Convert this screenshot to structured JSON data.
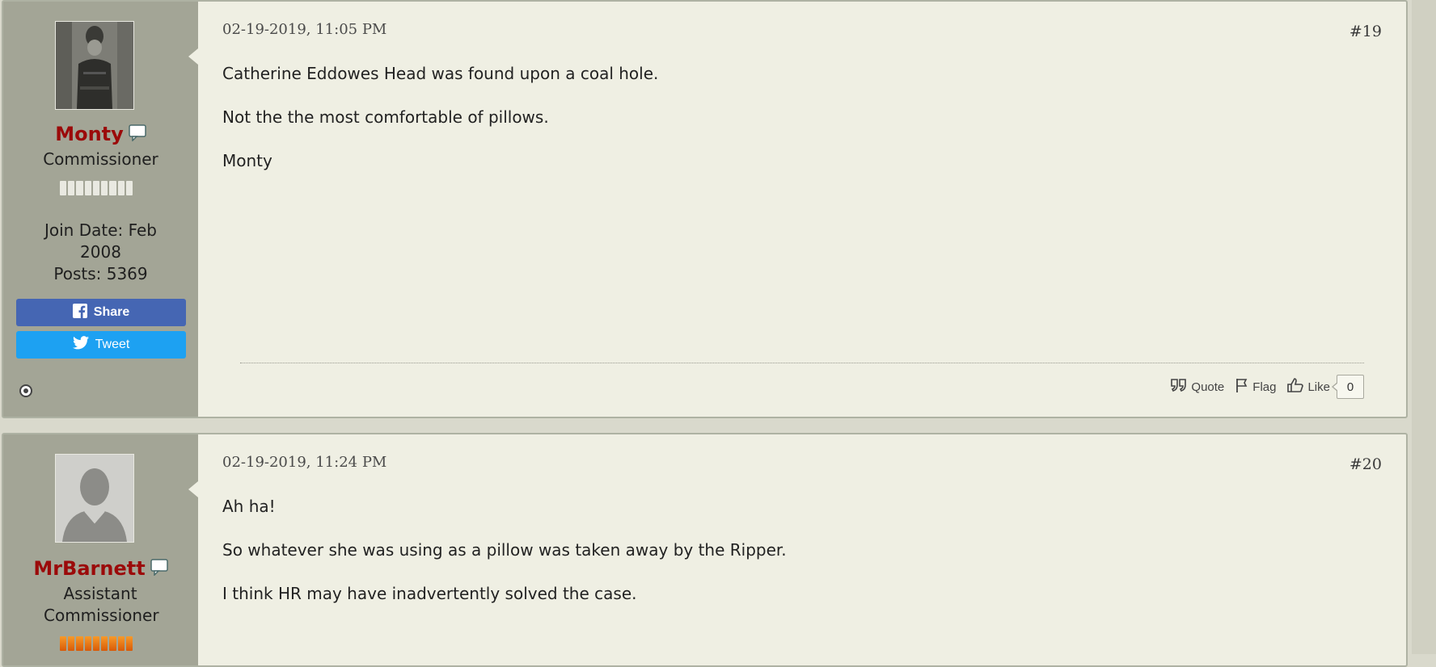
{
  "posts": [
    {
      "username": "Monty",
      "user_title": "Commissioner",
      "join_date": "Join Date: Feb 2008",
      "posts_count": "Posts: 5369",
      "share_label": "Share",
      "tweet_label": "Tweet",
      "date": "02-19-2019, 11:05 PM",
      "post_number": "#19",
      "paragraphs": [
        "Catherine Eddowes Head was found upon a coal hole.",
        "Not the the most comfortable of pillows.",
        "Monty"
      ],
      "actions": {
        "quote": "Quote",
        "flag": "Flag",
        "like": "Like",
        "like_count": "0"
      }
    },
    {
      "username": "MrBarnett",
      "user_title": "Assistant Commissioner",
      "date": "02-19-2019, 11:24 PM",
      "post_number": "#20",
      "paragraphs": [
        "Ah ha!",
        "So whatever she was using as a pillow was taken away by the Ripper.",
        "I think HR may have inadvertently solved the case."
      ]
    }
  ],
  "colors": {
    "username": "#9b0a0a",
    "sidebar": "#a3a596",
    "content_bg": "#efefe3",
    "share_bg": "#4566b3",
    "tweet_bg": "#1da1f2"
  }
}
